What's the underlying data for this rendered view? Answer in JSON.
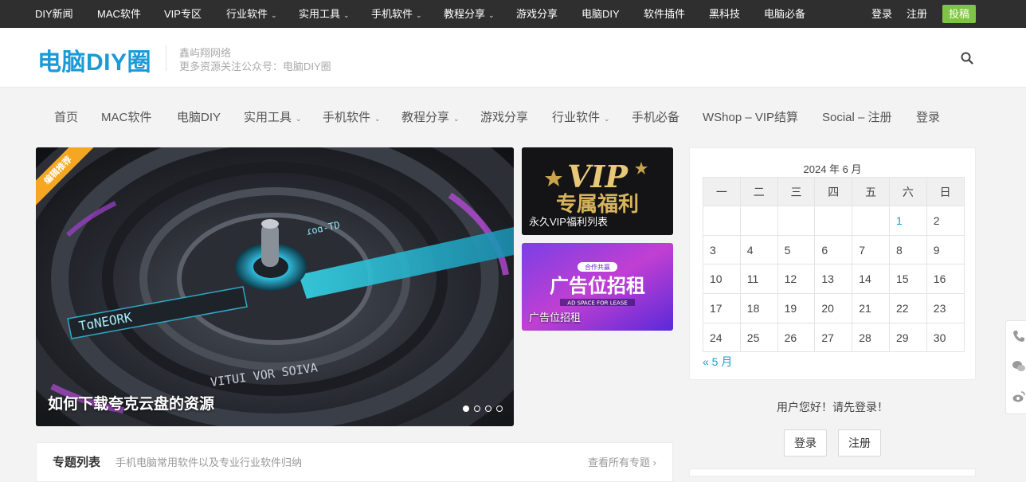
{
  "topbar": {
    "items": [
      {
        "label": "DIY新闻",
        "has_menu": false
      },
      {
        "label": "MAC软件",
        "has_menu": false
      },
      {
        "label": "VIP专区",
        "has_menu": false
      },
      {
        "label": "行业软件",
        "has_menu": true
      },
      {
        "label": "实用工具",
        "has_menu": true
      },
      {
        "label": "手机软件",
        "has_menu": true
      },
      {
        "label": "教程分享",
        "has_menu": true
      },
      {
        "label": "游戏分享",
        "has_menu": false
      },
      {
        "label": "电脑DIY",
        "has_menu": false
      },
      {
        "label": "软件插件",
        "has_menu": false
      },
      {
        "label": "黑科技",
        "has_menu": false
      },
      {
        "label": "电脑必备",
        "has_menu": false
      }
    ],
    "login": "登录",
    "register": "注册",
    "contribute": "投稿"
  },
  "header": {
    "logo": "电脑DIY圈",
    "tagline1": "鑫屿翔网络",
    "tagline2": "更多资源关注公众号：电脑DIY圈",
    "search_icon": "search-icon"
  },
  "mainnav": {
    "items": [
      {
        "label": "首页"
      },
      {
        "label": "MAC软件"
      },
      {
        "label": "电脑DIY"
      },
      {
        "label": "实用工具",
        "has_menu": true
      },
      {
        "label": "手机软件",
        "has_menu": true
      },
      {
        "label": "教程分享",
        "has_menu": true
      },
      {
        "label": "游戏分享"
      },
      {
        "label": "行业软件",
        "has_menu": true
      },
      {
        "label": "手机必备"
      },
      {
        "label": "WShop – VIP结算"
      },
      {
        "label": "Social – 注册"
      },
      {
        "label": "登录"
      }
    ]
  },
  "slider": {
    "badge": "编辑推荐",
    "title": "如何下载夸克云盘的资源",
    "total_slides": 4,
    "active_slide": 1,
    "image_texts": [
      "TɑNEORK",
      "ɾoɑ-TD",
      "VITUI VOR SOIVA"
    ]
  },
  "promos": [
    {
      "label": "永久VIP福利列表",
      "image_text_top": "VIP",
      "image_text_bottom": "专属福利"
    },
    {
      "label": "广告位招租",
      "image_text": "广告位招租",
      "image_subtext": "AD SPACE FOR LEASE",
      "image_badge": "合作共赢"
    }
  ],
  "calendar": {
    "caption": "2024 年 6 月",
    "weekdays": [
      "一",
      "二",
      "三",
      "四",
      "五",
      "六",
      "日"
    ],
    "weeks": [
      [
        "",
        "",
        "",
        "",
        "",
        "1",
        "2"
      ],
      [
        "3",
        "4",
        "5",
        "6",
        "7",
        "8",
        "9"
      ],
      [
        "10",
        "11",
        "12",
        "13",
        "14",
        "15",
        "16"
      ],
      [
        "17",
        "18",
        "19",
        "20",
        "21",
        "22",
        "23"
      ],
      [
        "24",
        "25",
        "26",
        "27",
        "28",
        "29",
        "30"
      ]
    ],
    "linked_days": [
      "1"
    ],
    "prev": "« 5 月"
  },
  "login_widget": {
    "greeting": "用户您好！请先登录！",
    "login_button": "登录",
    "register_button": "注册"
  },
  "topics": {
    "title": "专题列表",
    "desc": "手机电脑常用软件以及专业行业软件归纳",
    "more": "查看所有专题 ›"
  },
  "colors": {
    "topbar_bg": "#2f2f2f",
    "accent": "#1a9ad6",
    "contribute_bg": "#7fc444",
    "ribbon": "#f5a623"
  }
}
